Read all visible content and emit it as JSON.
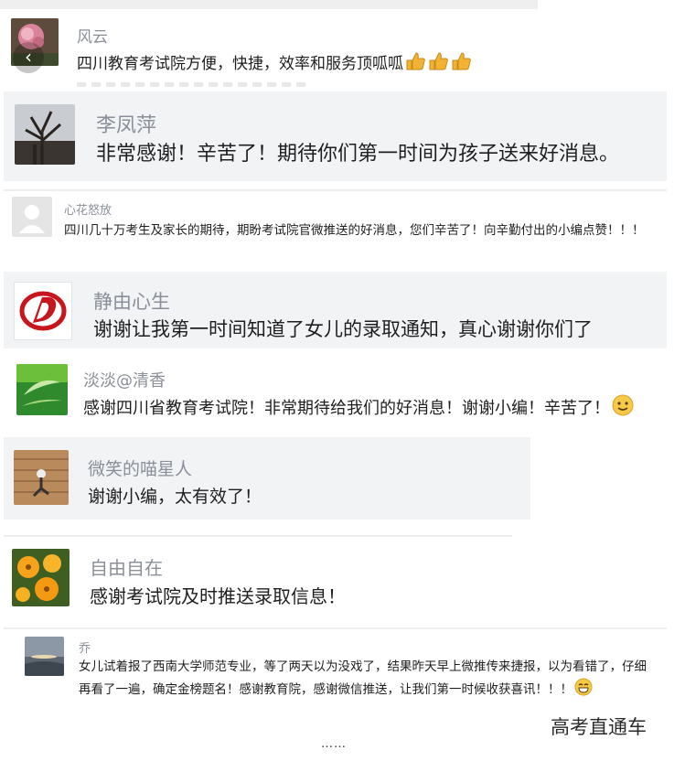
{
  "comments": [
    {
      "name": "风云",
      "text": "四川教育考试院方便，快捷，效率和服务顶呱呱"
    },
    {
      "name": "李凤萍",
      "text": "非常感谢！辛苦了！期待你们第一时间为孩子送来好消息。"
    },
    {
      "name": "心花怒放",
      "text": "四川几十万考生及家长的期待，期盼考试院官微推送的好消息，您们辛苦了！向辛勤付出的小编点赞！！！"
    },
    {
      "name": "静由心生",
      "text": "谢谢让我第一时间知道了女儿的录取通知，真心谢谢你们了"
    },
    {
      "name": "淡淡@清香",
      "text": "感谢四川省教育考试院！非常期待给我们的好消息！谢谢小编！辛苦了！"
    },
    {
      "name": "微笑的喵星人",
      "text": "谢谢小编，太有效了！"
    },
    {
      "name": "自由自在",
      "text": "感谢考试院及时推送录取信息！"
    },
    {
      "name": "乔",
      "text": "女儿试着报了西南大学师范专业，等了两天以为没戏了，结果昨天早上微推传来捷报，以为看错了，仔细再看了一遍，确定金榜题名！感谢教育院，感谢微信推送，让我们第一时候收获喜讯！！！"
    }
  ],
  "watermark": "高考直通车",
  "footer_ellipsis": "……",
  "icons": {
    "back": "chevron-left-icon",
    "thumbs": "thumbs-up-icon",
    "smile": "smile-emoji-icon",
    "grin": "grin-emoji-icon"
  }
}
